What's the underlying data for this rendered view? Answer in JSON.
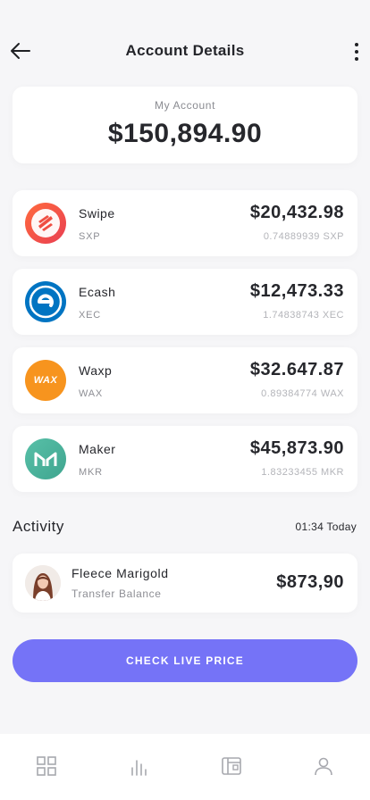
{
  "header": {
    "title": "Account Details",
    "back_icon": "arrow-left-icon",
    "menu_icon": "more-vertical-icon"
  },
  "account": {
    "label": "My Account",
    "balance": "$150,894.90"
  },
  "coins": [
    {
      "name": "Swipe",
      "symbol": "SXP",
      "usd": "$20,432.98",
      "amount": "0.74889939 SXP",
      "icon": "swipe-logo-icon",
      "color": "#f25a38"
    },
    {
      "name": "Ecash",
      "symbol": "XEC",
      "usd": "$12,473.33",
      "amount": "1.74838743 XEC",
      "icon": "ecash-logo-icon",
      "color": "#0074c2"
    },
    {
      "name": "Waxp",
      "symbol": "WAX",
      "usd": "$32.647.87",
      "amount": "0.89384774 WAX",
      "icon": "wax-logo-icon",
      "icon_text": "WAX",
      "color": "#f7941e"
    },
    {
      "name": "Maker",
      "symbol": "MKR",
      "usd": "$45,873.90",
      "amount": "1.83233455 MKR",
      "icon": "maker-logo-icon",
      "color": "#4fb59b"
    }
  ],
  "activity": {
    "title": "Activity",
    "time": "01:34 Today",
    "item": {
      "name": "Fleece Marigold",
      "subtitle": "Transfer Balance",
      "amount": "$873,90",
      "avatar": "user-avatar"
    }
  },
  "cta": {
    "label": "CHECK LIVE PRICE",
    "color": "#7573f7"
  },
  "tabbar": {
    "items": [
      {
        "icon": "grid-icon",
        "active": false
      },
      {
        "icon": "bar-chart-icon",
        "active": false
      },
      {
        "icon": "wallet-icon",
        "active": false
      },
      {
        "icon": "user-icon",
        "active": false
      }
    ]
  }
}
